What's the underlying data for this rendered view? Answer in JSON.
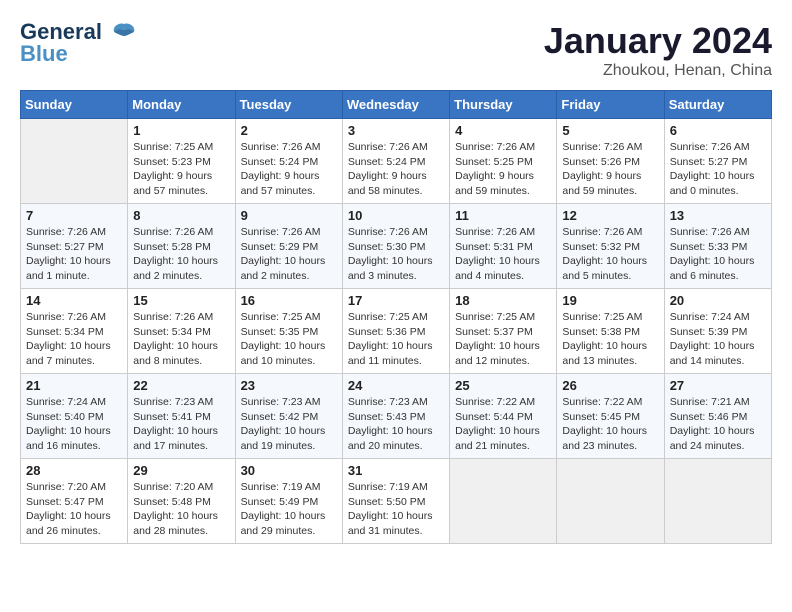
{
  "header": {
    "logo_line1": "General",
    "logo_line2": "Blue",
    "title": "January 2024",
    "subtitle": "Zhoukou, Henan, China"
  },
  "weekdays": [
    "Sunday",
    "Monday",
    "Tuesday",
    "Wednesday",
    "Thursday",
    "Friday",
    "Saturday"
  ],
  "weeks": [
    [
      {
        "day": "",
        "info": ""
      },
      {
        "day": "1",
        "info": "Sunrise: 7:25 AM\nSunset: 5:23 PM\nDaylight: 9 hours\nand 57 minutes."
      },
      {
        "day": "2",
        "info": "Sunrise: 7:26 AM\nSunset: 5:24 PM\nDaylight: 9 hours\nand 57 minutes."
      },
      {
        "day": "3",
        "info": "Sunrise: 7:26 AM\nSunset: 5:24 PM\nDaylight: 9 hours\nand 58 minutes."
      },
      {
        "day": "4",
        "info": "Sunrise: 7:26 AM\nSunset: 5:25 PM\nDaylight: 9 hours\nand 59 minutes."
      },
      {
        "day": "5",
        "info": "Sunrise: 7:26 AM\nSunset: 5:26 PM\nDaylight: 9 hours\nand 59 minutes."
      },
      {
        "day": "6",
        "info": "Sunrise: 7:26 AM\nSunset: 5:27 PM\nDaylight: 10 hours\nand 0 minutes."
      }
    ],
    [
      {
        "day": "7",
        "info": "Sunrise: 7:26 AM\nSunset: 5:27 PM\nDaylight: 10 hours\nand 1 minute."
      },
      {
        "day": "8",
        "info": "Sunrise: 7:26 AM\nSunset: 5:28 PM\nDaylight: 10 hours\nand 2 minutes."
      },
      {
        "day": "9",
        "info": "Sunrise: 7:26 AM\nSunset: 5:29 PM\nDaylight: 10 hours\nand 2 minutes."
      },
      {
        "day": "10",
        "info": "Sunrise: 7:26 AM\nSunset: 5:30 PM\nDaylight: 10 hours\nand 3 minutes."
      },
      {
        "day": "11",
        "info": "Sunrise: 7:26 AM\nSunset: 5:31 PM\nDaylight: 10 hours\nand 4 minutes."
      },
      {
        "day": "12",
        "info": "Sunrise: 7:26 AM\nSunset: 5:32 PM\nDaylight: 10 hours\nand 5 minutes."
      },
      {
        "day": "13",
        "info": "Sunrise: 7:26 AM\nSunset: 5:33 PM\nDaylight: 10 hours\nand 6 minutes."
      }
    ],
    [
      {
        "day": "14",
        "info": "Sunrise: 7:26 AM\nSunset: 5:34 PM\nDaylight: 10 hours\nand 7 minutes."
      },
      {
        "day": "15",
        "info": "Sunrise: 7:26 AM\nSunset: 5:34 PM\nDaylight: 10 hours\nand 8 minutes."
      },
      {
        "day": "16",
        "info": "Sunrise: 7:25 AM\nSunset: 5:35 PM\nDaylight: 10 hours\nand 10 minutes."
      },
      {
        "day": "17",
        "info": "Sunrise: 7:25 AM\nSunset: 5:36 PM\nDaylight: 10 hours\nand 11 minutes."
      },
      {
        "day": "18",
        "info": "Sunrise: 7:25 AM\nSunset: 5:37 PM\nDaylight: 10 hours\nand 12 minutes."
      },
      {
        "day": "19",
        "info": "Sunrise: 7:25 AM\nSunset: 5:38 PM\nDaylight: 10 hours\nand 13 minutes."
      },
      {
        "day": "20",
        "info": "Sunrise: 7:24 AM\nSunset: 5:39 PM\nDaylight: 10 hours\nand 14 minutes."
      }
    ],
    [
      {
        "day": "21",
        "info": "Sunrise: 7:24 AM\nSunset: 5:40 PM\nDaylight: 10 hours\nand 16 minutes."
      },
      {
        "day": "22",
        "info": "Sunrise: 7:23 AM\nSunset: 5:41 PM\nDaylight: 10 hours\nand 17 minutes."
      },
      {
        "day": "23",
        "info": "Sunrise: 7:23 AM\nSunset: 5:42 PM\nDaylight: 10 hours\nand 19 minutes."
      },
      {
        "day": "24",
        "info": "Sunrise: 7:23 AM\nSunset: 5:43 PM\nDaylight: 10 hours\nand 20 minutes."
      },
      {
        "day": "25",
        "info": "Sunrise: 7:22 AM\nSunset: 5:44 PM\nDaylight: 10 hours\nand 21 minutes."
      },
      {
        "day": "26",
        "info": "Sunrise: 7:22 AM\nSunset: 5:45 PM\nDaylight: 10 hours\nand 23 minutes."
      },
      {
        "day": "27",
        "info": "Sunrise: 7:21 AM\nSunset: 5:46 PM\nDaylight: 10 hours\nand 24 minutes."
      }
    ],
    [
      {
        "day": "28",
        "info": "Sunrise: 7:20 AM\nSunset: 5:47 PM\nDaylight: 10 hours\nand 26 minutes."
      },
      {
        "day": "29",
        "info": "Sunrise: 7:20 AM\nSunset: 5:48 PM\nDaylight: 10 hours\nand 28 minutes."
      },
      {
        "day": "30",
        "info": "Sunrise: 7:19 AM\nSunset: 5:49 PM\nDaylight: 10 hours\nand 29 minutes."
      },
      {
        "day": "31",
        "info": "Sunrise: 7:19 AM\nSunset: 5:50 PM\nDaylight: 10 hours\nand 31 minutes."
      },
      {
        "day": "",
        "info": ""
      },
      {
        "day": "",
        "info": ""
      },
      {
        "day": "",
        "info": ""
      }
    ]
  ]
}
